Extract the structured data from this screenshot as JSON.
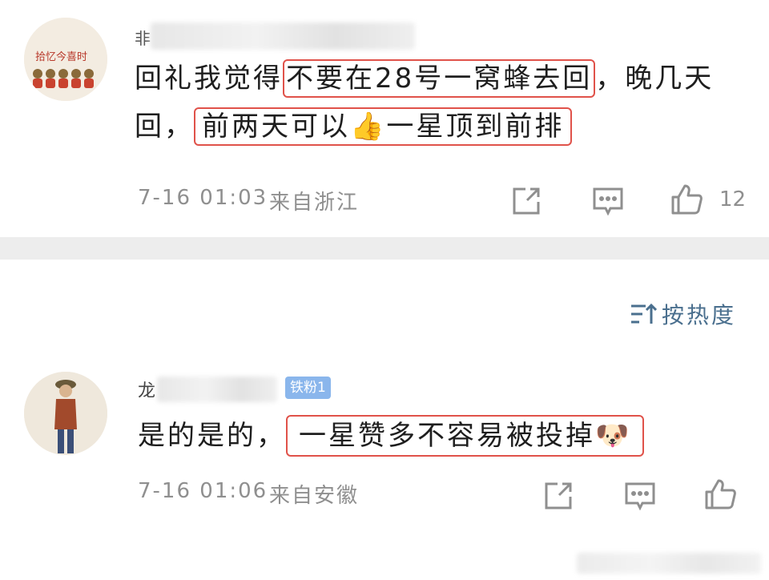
{
  "comments": [
    {
      "avatar_text": "拾忆今喜时",
      "author_visible": "非",
      "text": "回礼我觉得不要在28号一窝蜂去回，晚几天回，前两天可以👍一星顶到前排",
      "line1_pre": "回礼我觉得",
      "line1_box": "不要在28号一窝蜂去回",
      "line1_post": "，晚几天",
      "line2_pre": "回，",
      "line2_box": "前两天可以👍一星顶到前排",
      "time": "7-16 01:03",
      "location": "来自浙江",
      "like_count": "12"
    },
    {
      "author_visible": "龙",
      "fan_badge": "铁粉1",
      "text": "是的是的，一星赞多不容易被投掉🐶",
      "line1_pre": "是的是的，",
      "line1_box": "一星赞多不容易被投掉🐶",
      "time": "7-16 01:06",
      "location": "来自安徽",
      "like_count": ""
    }
  ],
  "sort_label": "按热度",
  "icons": {
    "share": "share-icon",
    "comment": "comment-icon",
    "like": "thumbs-up-icon",
    "sort": "sort-icon"
  },
  "colors": {
    "highlight_box": "#e0524a",
    "sort_text": "#4a6f8e",
    "meta_text": "#8f8f8f",
    "divider": "#ededed",
    "fan_badge": "#8ab6ec"
  }
}
